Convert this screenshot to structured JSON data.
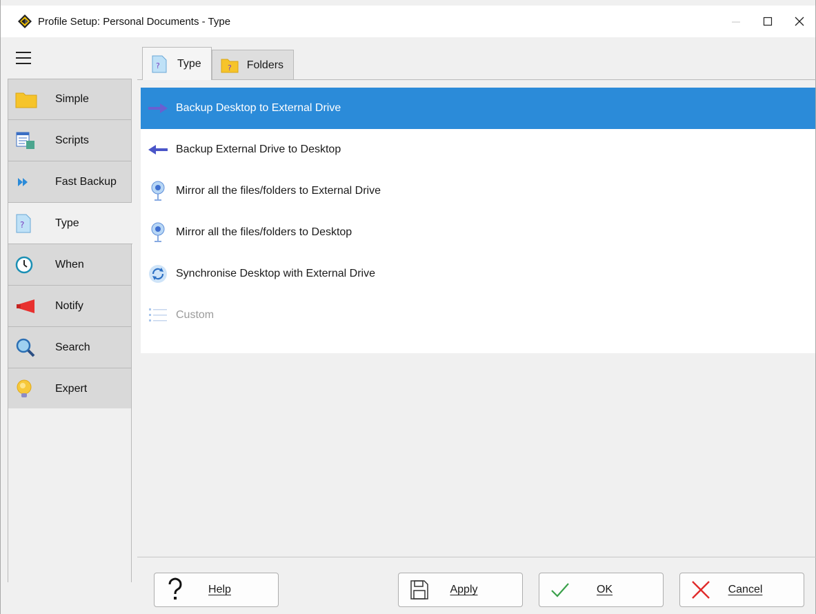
{
  "window": {
    "title": "Profile Setup: Personal Documents - Type"
  },
  "sidebar": {
    "items": [
      {
        "label": "Simple",
        "icon": "folder-icon"
      },
      {
        "label": "Scripts",
        "icon": "script-icon"
      },
      {
        "label": "Fast Backup",
        "icon": "fast-forward-icon"
      },
      {
        "label": "Type",
        "icon": "question-document-icon"
      },
      {
        "label": "When",
        "icon": "clock-icon"
      },
      {
        "label": "Notify",
        "icon": "megaphone-icon"
      },
      {
        "label": "Search",
        "icon": "magnifier-icon"
      },
      {
        "label": "Expert",
        "icon": "lightbulb-icon"
      }
    ],
    "active": "Type"
  },
  "tabs": [
    {
      "label": "Type",
      "icon": "question-document-icon"
    },
    {
      "label": "Folders",
      "icon": "question-folder-icon"
    }
  ],
  "list": {
    "items": [
      {
        "label": "Backup Desktop to External Drive",
        "icon": "arrow-right-icon",
        "selected": true
      },
      {
        "label": "Backup External Drive to Desktop",
        "icon": "arrow-left-icon"
      },
      {
        "label": "Mirror all the files/folders to External Drive",
        "icon": "mirror-icon"
      },
      {
        "label": "Mirror all the files/folders to Desktop",
        "icon": "mirror-icon"
      },
      {
        "label": "Synchronise Desktop with External Drive",
        "icon": "sync-icon"
      },
      {
        "label": "Custom",
        "icon": "list-icon",
        "disabled": true
      }
    ]
  },
  "buttons": {
    "help": "Help",
    "apply": "Apply",
    "ok": "OK",
    "cancel": "Cancel"
  },
  "colors": {
    "selection": "#2b8bd9",
    "accent_arrow": "#4a55c8"
  }
}
